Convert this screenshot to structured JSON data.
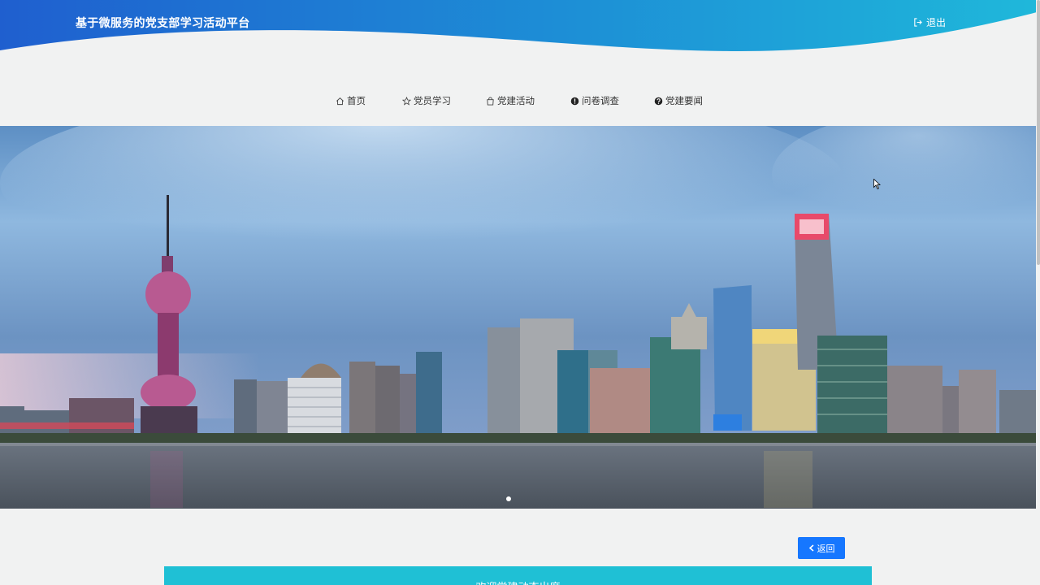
{
  "header": {
    "site_title": "基于微服务的党支部学习活动平台",
    "logout_label": "退出",
    "logout_icon": "logout-icon"
  },
  "nav": {
    "items": [
      {
        "label": "首页",
        "icon": "home-icon"
      },
      {
        "label": "党员学习",
        "icon": "star-icon"
      },
      {
        "label": "党建活动",
        "icon": "bag-icon"
      },
      {
        "label": "问卷调查",
        "icon": "info-circle-icon"
      },
      {
        "label": "党建要闻",
        "icon": "question-circle-icon"
      }
    ]
  },
  "banner": {
    "slide_count_visible": 1,
    "active_slide": 1
  },
  "back_button": {
    "label": "返回",
    "icon": "arrow-left-icon"
  },
  "panel": {
    "title": "欢迎党建动态出席"
  },
  "colors": {
    "header_blue": "#1f5fcf",
    "header_cyan": "#1fb6d9",
    "button_blue": "#1677ff",
    "panel_cyan": "#1fc0d5",
    "page_bg": "#f1f2f2"
  }
}
